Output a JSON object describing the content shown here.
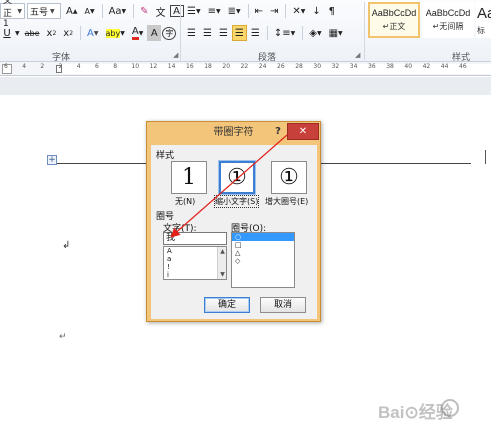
{
  "ribbon": {
    "row1": {
      "font_name": "文正1",
      "font_size": "五号",
      "grow_font": "A",
      "shrink_font": "A",
      "change_case": "Aa",
      "phonetic": "文",
      "char_border": "A"
    },
    "row2": {
      "underline": "U",
      "strike": "abe",
      "subscript": "x",
      "superscript": "x",
      "text_effect": "A",
      "highlight": "aby",
      "font_color": "A",
      "char_shading": "A",
      "enclose": "字"
    },
    "groups": {
      "font": "字体",
      "paragraph": "段落",
      "styles": "样式"
    },
    "styles": [
      {
        "sample": "AaBbCcDd",
        "name": "↵正文"
      },
      {
        "sample": "AaBbCcDd",
        "name": "↵无间隔"
      },
      {
        "sample": "Aa",
        "name": "标"
      }
    ]
  },
  "ruler": {
    "ticks": [
      "6",
      "4",
      "2",
      "2",
      "4",
      "6",
      "8",
      "10",
      "12",
      "14",
      "16",
      "18",
      "20",
      "22",
      "24",
      "26",
      "28",
      "30",
      "32",
      "34",
      "36",
      "38",
      "40",
      "42",
      "44",
      "46"
    ]
  },
  "document": {
    "caret": "↲",
    "para_mark": "↵",
    "table_handle": "+"
  },
  "dialog": {
    "title": "带圈字符",
    "help": "?",
    "close": "✕",
    "style_section": "样式",
    "options": [
      {
        "glyph": "1",
        "label": "无(N)"
      },
      {
        "glyph": "①",
        "label": "缩小文字(S)"
      },
      {
        "glyph": "①",
        "label": "增大圈号(E)"
      }
    ],
    "enclosure_section": "圈号",
    "text_label": "文字(T):",
    "text_value": "我",
    "text_list": [
      "A",
      "a",
      "!",
      "i"
    ],
    "enclosure_label": "圈号(O):",
    "enclosure_list": [
      "○",
      "□",
      "△",
      "◇"
    ],
    "ok": "确定",
    "cancel": "取消"
  },
  "watermark": {
    "text": "Bai⊙经验"
  },
  "colors": {
    "dialog_frame": "#f3c57a",
    "close_button": "#c7413a",
    "annotation_arrow": "#e0211b",
    "selection": "#3399ff"
  }
}
